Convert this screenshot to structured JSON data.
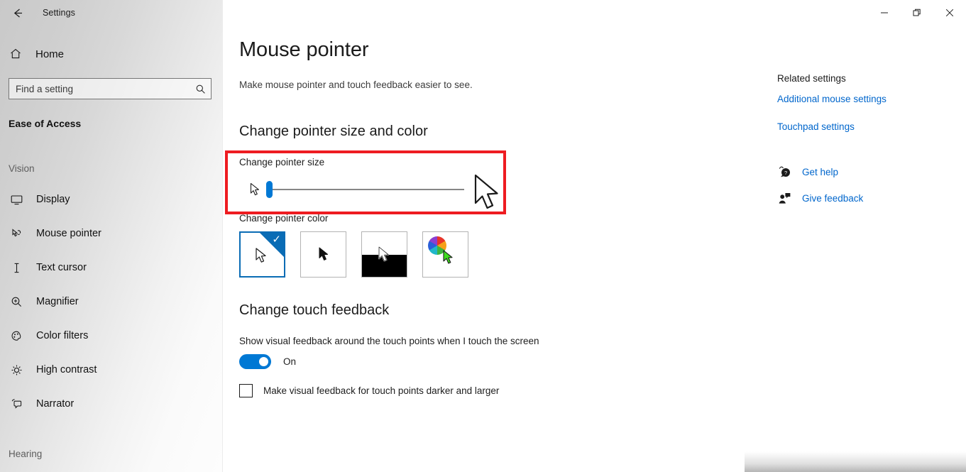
{
  "window": {
    "app_title": "Settings",
    "back_icon": "back-arrow-icon",
    "minimize_label": "─",
    "maximize_label": "❐",
    "close_label": "✕"
  },
  "sidebar": {
    "home_label": "Home",
    "home_icon": "home-icon",
    "search": {
      "placeholder": "Find a setting",
      "value": "",
      "icon": "search-icon"
    },
    "category": "Ease of Access",
    "groups": [
      {
        "label": "Vision"
      },
      {
        "label": "Hearing"
      }
    ],
    "items": [
      {
        "label": "Display",
        "icon": "monitor-icon"
      },
      {
        "label": "Mouse pointer",
        "icon": "mouse-pointer-hand-icon"
      },
      {
        "label": "Text cursor",
        "icon": "text-cursor-icon"
      },
      {
        "label": "Magnifier",
        "icon": "magnifier-icon"
      },
      {
        "label": "Color filters",
        "icon": "palette-icon"
      },
      {
        "label": "High contrast",
        "icon": "brightness-icon"
      },
      {
        "label": "Narrator",
        "icon": "narrator-icon"
      }
    ]
  },
  "main": {
    "title": "Mouse pointer",
    "subtitle": "Make mouse pointer and touch feedback easier to see.",
    "pointer_section": {
      "heading": "Change pointer size and color",
      "size_label": "Change pointer size",
      "slider": {
        "value": 1,
        "min": 1,
        "max": 15,
        "accent": "#0078d4"
      },
      "color_label": "Change pointer color",
      "color_options": [
        {
          "name": "white-pointer",
          "selected": true,
          "check_glyph": "✓"
        },
        {
          "name": "black-pointer",
          "selected": false
        },
        {
          "name": "inverted-pointer",
          "selected": false
        },
        {
          "name": "custom-color-pointer",
          "selected": false
        }
      ]
    },
    "touch_section": {
      "heading": "Change touch feedback",
      "toggle_description": "Show visual feedback around the touch points when I touch the screen",
      "toggle_state": "On",
      "toggle_on": true,
      "checkbox_label": "Make visual feedback for touch points darker and larger",
      "checkbox_checked": false
    }
  },
  "related": {
    "heading": "Related settings",
    "links": [
      {
        "label": "Additional mouse settings"
      },
      {
        "label": "Touchpad settings"
      }
    ],
    "help": [
      {
        "label": "Get help",
        "icon": "help-bubble-icon"
      },
      {
        "label": "Give feedback",
        "icon": "feedback-person-icon"
      }
    ]
  },
  "annotation": {
    "color": "#ee1c21",
    "target": "change-pointer-size"
  }
}
